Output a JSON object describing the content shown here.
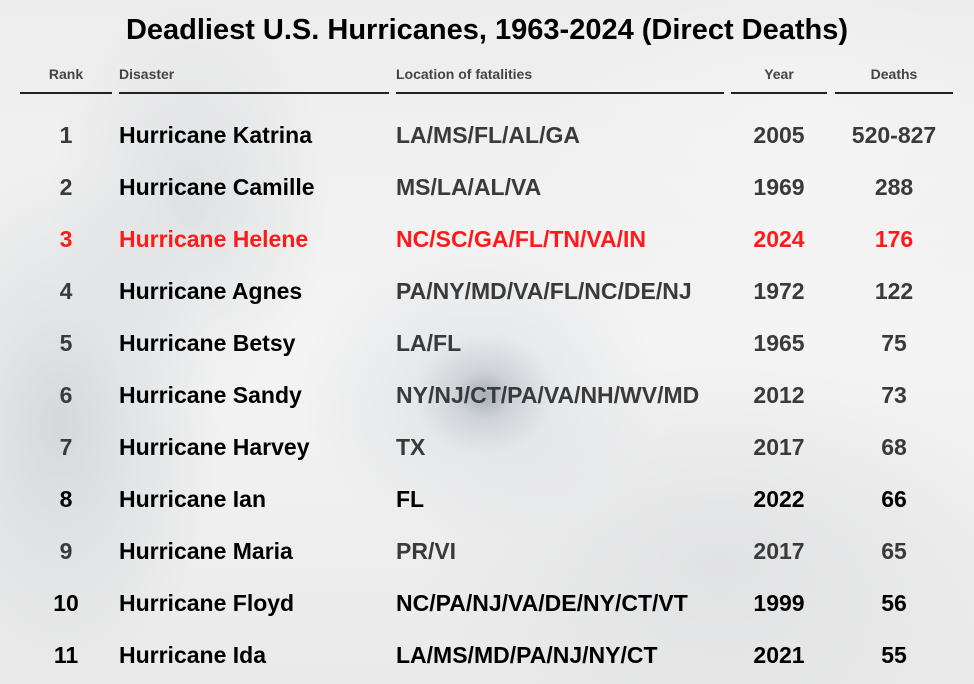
{
  "title": "Deadliest U.S. Hurricanes, 1963-2024 (Direct Deaths)",
  "colors": {
    "highlight": "#ff1a1a",
    "bold_text": "#000000",
    "muted_text": "#3a3a3a"
  },
  "chart_data": {
    "type": "table",
    "title": "Deadliest U.S. Hurricanes, 1963-2024 (Direct Deaths)",
    "columns": [
      "Rank",
      "Disaster",
      "Location of fatalities",
      "Year",
      "Deaths"
    ],
    "rows": [
      {
        "rank": "1",
        "disaster": "Hurricane Katrina",
        "location": "LA/MS/FL/AL/GA",
        "year": "2005",
        "deaths": "520-827",
        "style": "muted"
      },
      {
        "rank": "2",
        "disaster": "Hurricane Camille",
        "location": "MS/LA/AL/VA",
        "year": "1969",
        "deaths": "288",
        "style": "muted"
      },
      {
        "rank": "3",
        "disaster": "Hurricane Helene",
        "location": "NC/SC/GA/FL/TN/VA/IN",
        "year": "2024",
        "deaths": "176",
        "style": "highlight"
      },
      {
        "rank": "4",
        "disaster": "Hurricane Agnes",
        "location": "PA/NY/MD/VA/FL/NC/DE/NJ",
        "year": "1972",
        "deaths": "122",
        "style": "muted"
      },
      {
        "rank": "5",
        "disaster": "Hurricane Betsy",
        "location": "LA/FL",
        "year": "1965",
        "deaths": "75",
        "style": "muted"
      },
      {
        "rank": "6",
        "disaster": "Hurricane Sandy",
        "location": "NY/NJ/CT/PA/VA/NH/WV/MD",
        "year": "2012",
        "deaths": "73",
        "style": "muted"
      },
      {
        "rank": "7",
        "disaster": "Hurricane Harvey",
        "location": "TX",
        "year": "2017",
        "deaths": "68",
        "style": "muted"
      },
      {
        "rank": "8",
        "disaster": "Hurricane Ian",
        "location": "FL",
        "year": "2022",
        "deaths": "66",
        "style": "bold"
      },
      {
        "rank": "9",
        "disaster": "Hurricane Maria",
        "location": "PR/VI",
        "year": "2017",
        "deaths": "65",
        "style": "muted"
      },
      {
        "rank": "10",
        "disaster": "Hurricane Floyd",
        "location": "NC/PA/NJ/VA/DE/NY/CT/VT",
        "year": "1999",
        "deaths": "56",
        "style": "bold"
      },
      {
        "rank": "11",
        "disaster": "Hurricane Ida",
        "location": "LA/MS/MD/PA/NJ/NY/CT",
        "year": "2021",
        "deaths": "55",
        "style": "bold"
      }
    ]
  }
}
